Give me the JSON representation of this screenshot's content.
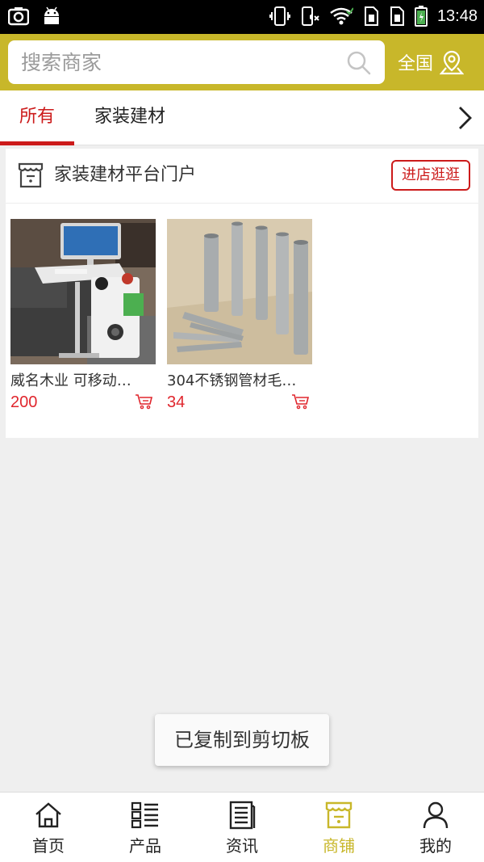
{
  "status_bar": {
    "time": "13:48",
    "icons": [
      "screenshot-icon",
      "android-icon",
      "vibrate-icon",
      "mute-icon",
      "wifi-icon",
      "sim1-icon",
      "sim2-icon",
      "battery-icon"
    ]
  },
  "header": {
    "search_placeholder": "搜索商家",
    "region_label": "全国",
    "accent_color": "#c8b72a"
  },
  "tabs": {
    "items": [
      {
        "label": "所有",
        "active": true
      },
      {
        "label": "家装建材",
        "active": false
      }
    ]
  },
  "shop": {
    "name": "家装建材平台门户",
    "enter_label": "进店逛逛",
    "products": [
      {
        "name": "威名木业 可移动…",
        "price": "200"
      },
      {
        "name": "304不锈钢管材毛…",
        "price": "34"
      }
    ]
  },
  "toast": {
    "text": "已复制到剪切板"
  },
  "bottom_nav": {
    "items": [
      {
        "label": "首页",
        "icon": "home-icon"
      },
      {
        "label": "产品",
        "icon": "grid-list-icon"
      },
      {
        "label": "资讯",
        "icon": "news-icon"
      },
      {
        "label": "商铺",
        "icon": "store-icon",
        "active": true
      },
      {
        "label": "我的",
        "icon": "user-icon"
      }
    ]
  },
  "colors": {
    "active_red": "#cc1b1b",
    "price_red": "#e0262d",
    "active_gold": "#c8b72a"
  }
}
